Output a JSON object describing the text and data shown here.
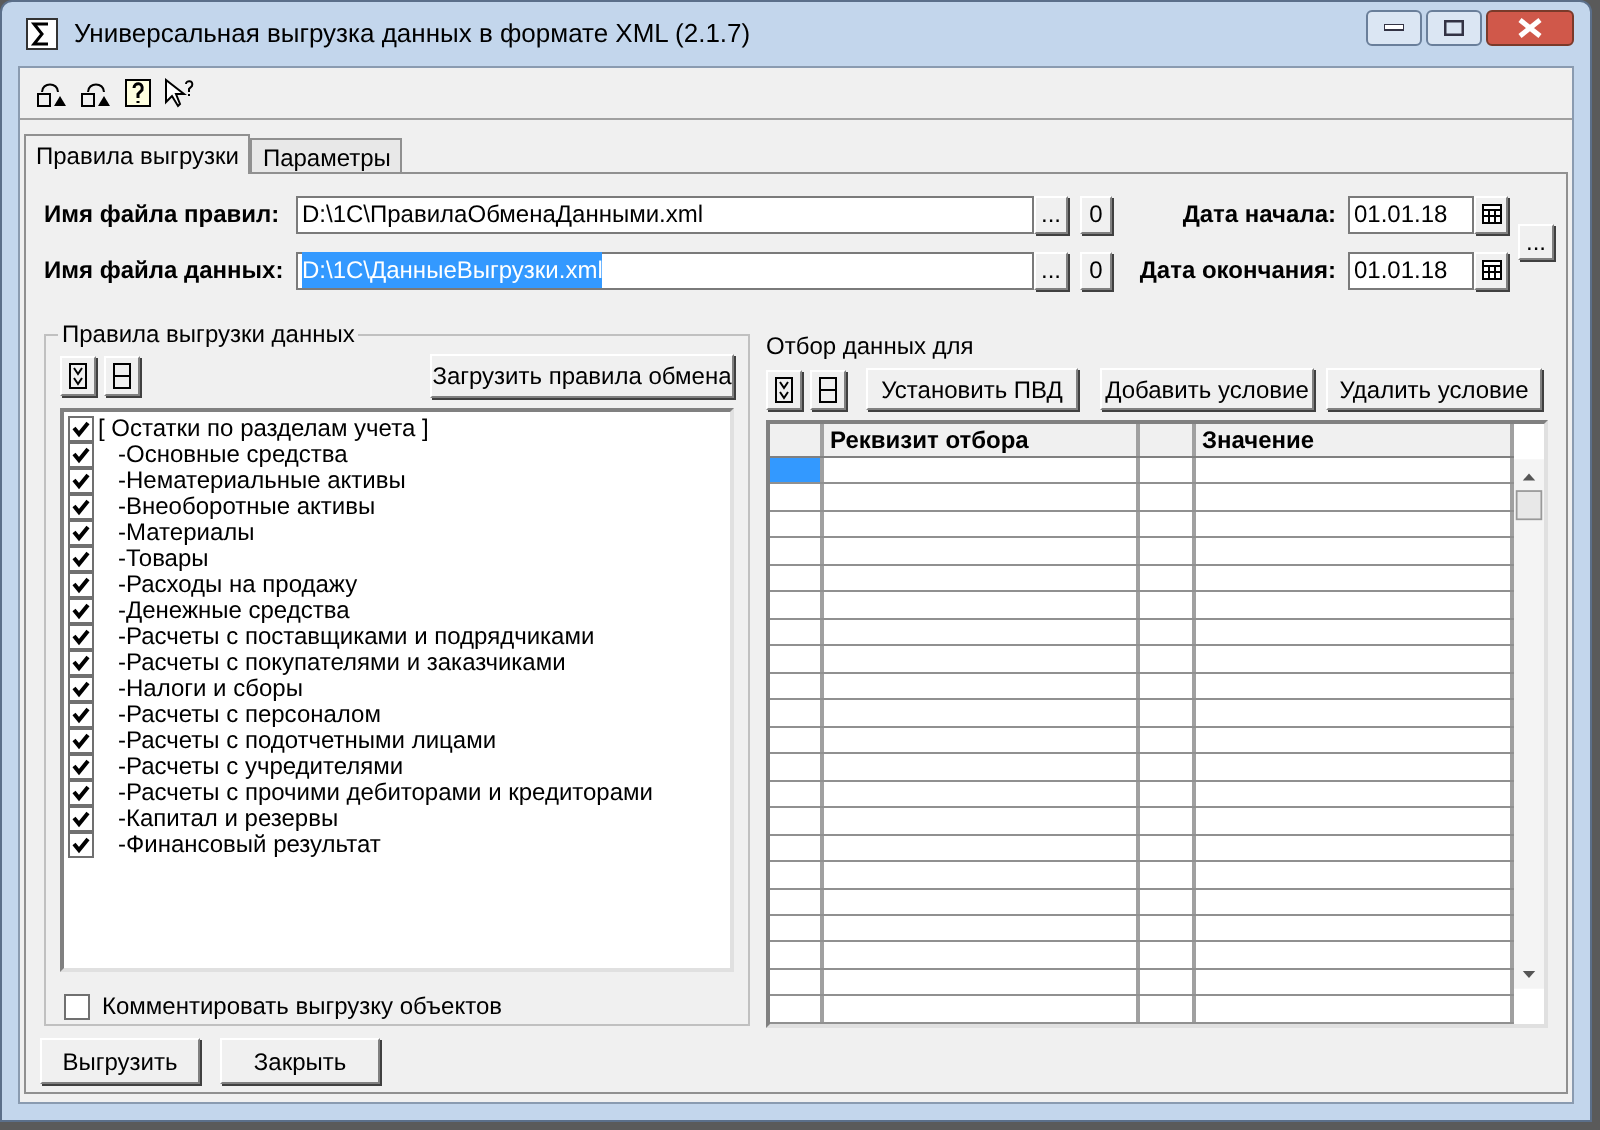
{
  "window": {
    "title": "Универсальная выгрузка данных в формате XML (2.1.7)"
  },
  "tabs": [
    {
      "label": "Правила выгрузки",
      "selected": true
    },
    {
      "label": "Параметры",
      "selected": false
    }
  ],
  "fields": [
    {
      "label": "Имя файла правил:",
      "value": "D:\\1C\\ПравилаОбменаДанными.xml",
      "selected_text": false,
      "browse": "...",
      "clear": "0"
    },
    {
      "label": "Имя файла данных:",
      "value": "D:\\1C\\ДанныеВыгрузки.xml",
      "selected_text": true,
      "browse": "...",
      "clear": "0"
    }
  ],
  "dates": [
    {
      "label": "Дата начала:",
      "value": "01.01.18"
    },
    {
      "label": "Дата окончания:",
      "value": "01.01.18"
    }
  ],
  "period_button": "...",
  "rules_group": {
    "title": "Правила выгрузки данных",
    "load_button": "Загрузить правила обмена",
    "tree": [
      {
        "label": "[ Остатки по разделам учета ]",
        "checked": true,
        "children": [
          {
            "label": "-Основные средства",
            "checked": true
          },
          {
            "label": "-Нематериальные активы",
            "checked": true
          },
          {
            "label": "-Внеоборотные активы",
            "checked": true
          },
          {
            "label": "-Материалы",
            "checked": true
          },
          {
            "label": "-Товары",
            "checked": true
          },
          {
            "label": "-Расходы на продажу",
            "checked": true
          },
          {
            "label": "-Денежные средства",
            "checked": true
          },
          {
            "label": "-Расчеты с поставщиками и подрядчиками",
            "checked": true
          },
          {
            "label": "-Расчеты с покупателями и заказчиками",
            "checked": true
          },
          {
            "label": "-Налоги и сборы",
            "checked": true
          },
          {
            "label": "-Расчеты с персоналом",
            "checked": true
          },
          {
            "label": "-Расчеты с подотчетными лицами",
            "checked": true
          },
          {
            "label": "-Расчеты с учредителями",
            "checked": true
          },
          {
            "label": "-Расчеты с прочими дебиторами и кредиторами",
            "checked": true
          },
          {
            "label": "-Капитал и резервы",
            "checked": true
          },
          {
            "label": "-Финансовый результат",
            "checked": true
          }
        ]
      }
    ],
    "comment_option": {
      "label": "Комментировать выгрузку объектов",
      "checked": false
    }
  },
  "filter": {
    "title": "Отбор данных для",
    "buttons": [
      "Установить ПВД",
      "Добавить условие",
      "Удалить условие"
    ],
    "table": {
      "columns": [
        "",
        "Реквизит отбора",
        "",
        "Значение"
      ],
      "rows": [
        {
          "selected": true
        },
        {
          "selected": false
        },
        {
          "selected": false
        },
        {
          "selected": false
        },
        {
          "selected": false
        },
        {
          "selected": false
        },
        {
          "selected": false
        },
        {
          "selected": false
        },
        {
          "selected": false
        },
        {
          "selected": false
        },
        {
          "selected": false
        },
        {
          "selected": false
        },
        {
          "selected": false
        },
        {
          "selected": false
        },
        {
          "selected": false
        },
        {
          "selected": false
        },
        {
          "selected": false
        },
        {
          "selected": false
        },
        {
          "selected": false
        },
        {
          "selected": false
        },
        {
          "selected": false
        }
      ]
    }
  },
  "footer_buttons": [
    "Выгрузить",
    "Закрыть"
  ]
}
